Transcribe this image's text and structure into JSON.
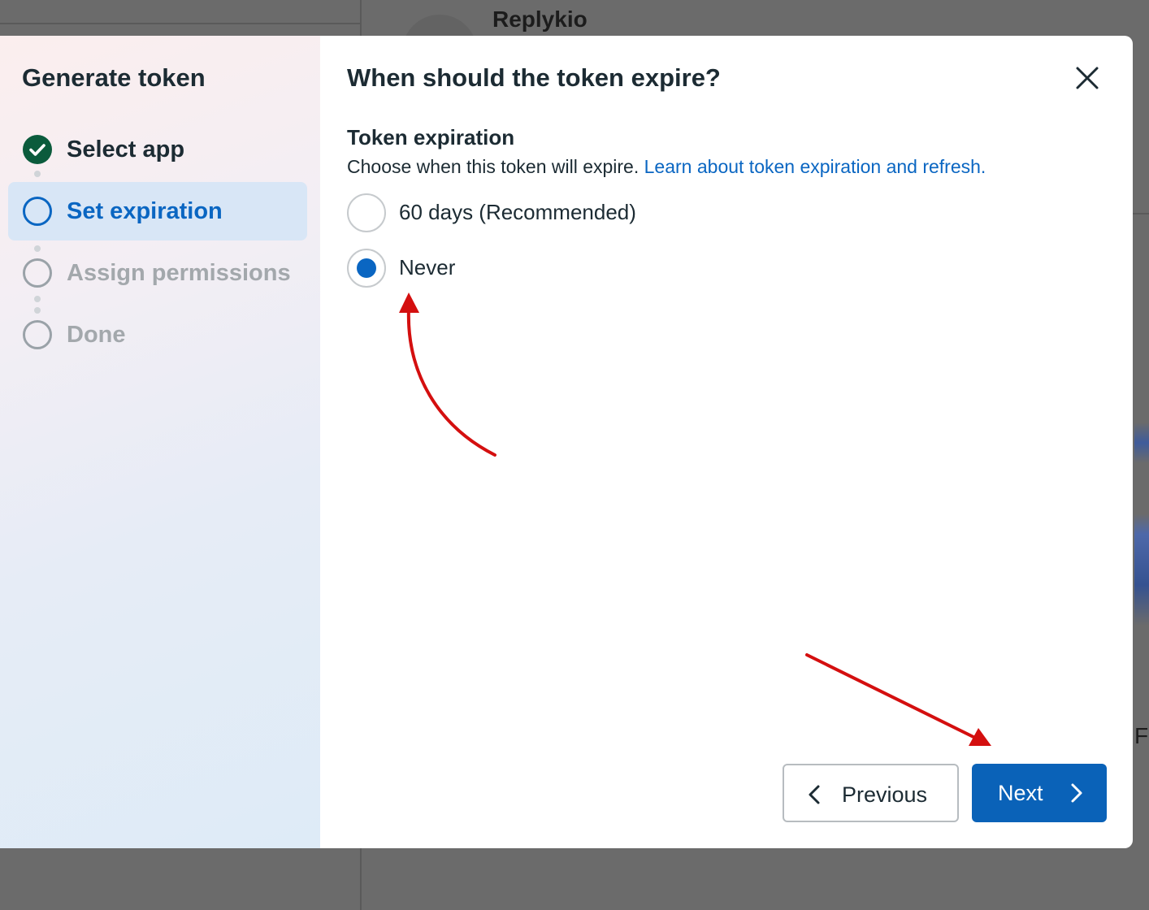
{
  "background": {
    "page_title": "Replykio",
    "edge_text": "F"
  },
  "sidebar": {
    "title": "Generate token",
    "steps": [
      {
        "label": "Select app",
        "state": "done"
      },
      {
        "label": "Set expiration",
        "state": "current"
      },
      {
        "label": "Assign permissions",
        "state": "pending"
      },
      {
        "label": "Done",
        "state": "pending"
      }
    ]
  },
  "main": {
    "title": "When should the token expire?",
    "section_title": "Token expiration",
    "description": "Choose when this token will expire.",
    "link_text": "Learn about token expiration and refresh.",
    "options": [
      {
        "label": "60 days (Recommended)",
        "selected": false
      },
      {
        "label": "Never",
        "selected": true
      }
    ]
  },
  "footer": {
    "previous_label": "Previous",
    "next_label": "Next"
  },
  "icons": {
    "close": "close-icon",
    "check": "check-icon",
    "previous": "chevron-left-icon",
    "next": "chevron-right-icon"
  },
  "colors": {
    "accent": "#0a66c2",
    "done": "#0b5b3c",
    "annotation": "#d40f0f"
  }
}
